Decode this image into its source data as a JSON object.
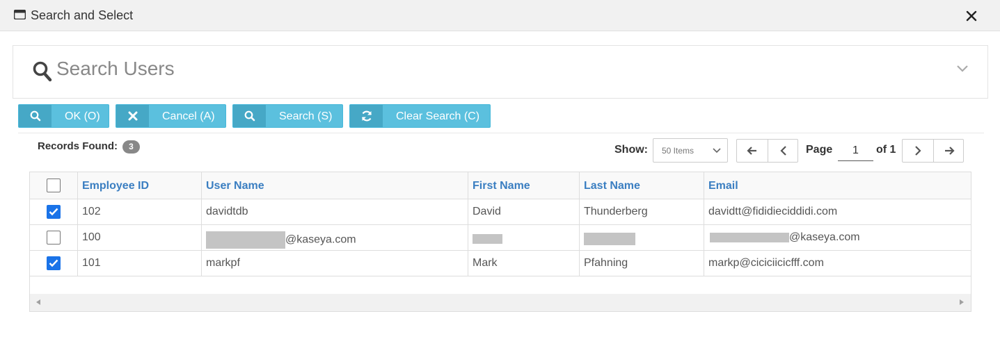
{
  "window": {
    "title": "Search and Select",
    "icon": "window-icon",
    "close_icon": "close-icon"
  },
  "search_panel": {
    "title": "Search Users",
    "icon": "search-icon",
    "toggle_icon": "chevron-down-icon"
  },
  "toolbar": [
    {
      "label": "OK (O)",
      "icon": "search-icon"
    },
    {
      "label": "Cancel (A)",
      "icon": "x-icon"
    },
    {
      "label": "Search (S)",
      "icon": "search-icon"
    },
    {
      "label": "Clear Search (C)",
      "icon": "refresh-icon"
    }
  ],
  "records": {
    "label": "Records Found:",
    "count": "3"
  },
  "pagination": {
    "show_label": "Show:",
    "page_size": "50 Items",
    "page_label": "Page",
    "page": "1",
    "of_label": "of 1"
  },
  "table": {
    "columns": [
      "Employee ID",
      "User Name",
      "First Name",
      "Last Name",
      "Email"
    ],
    "rows": [
      {
        "checked": true,
        "employee_id": "102",
        "user_name": "davidtdb",
        "first_name": "David",
        "last_name": "Thunderberg",
        "email": "davidtt@fididieciddidi.com"
      },
      {
        "checked": false,
        "employee_id": "100",
        "user_name": "@kaseya.com",
        "first_name": "",
        "last_name": "",
        "email": "@kaseya.com"
      },
      {
        "checked": true,
        "employee_id": "101",
        "user_name": "markpf",
        "first_name": "Mark",
        "last_name": "Pfahning",
        "email": "markp@ciciciicicfff.com"
      }
    ]
  },
  "colors": {
    "button": "#5bc0de",
    "button_icon_bg": "#46a8c6",
    "link_header": "#3a7ec1",
    "checkbox": "#1a73e8"
  }
}
